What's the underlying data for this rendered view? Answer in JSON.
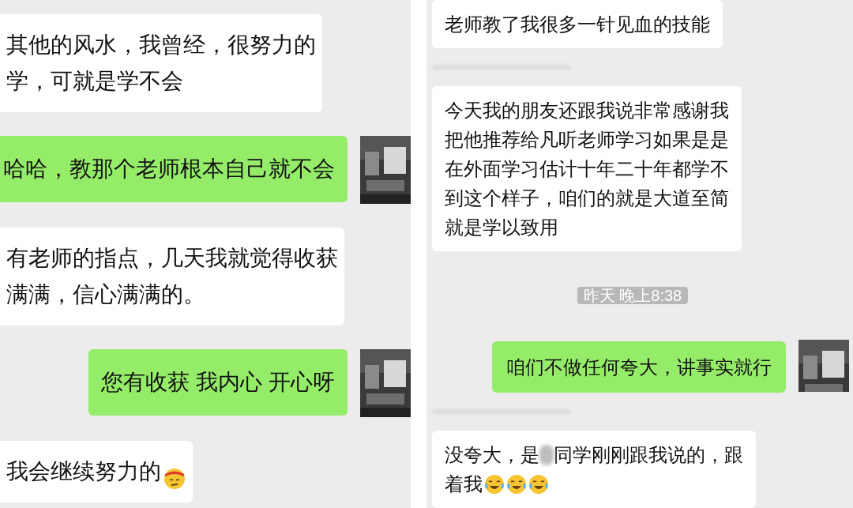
{
  "panels": [
    {
      "messages": [
        {
          "kind": "incoming",
          "lines": [
            "其他的风水，我曾经，很努力的",
            "学，可就是学不会"
          ]
        },
        {
          "kind": "outgoing",
          "lines": [
            "哈哈，教那个老师根本自己就不会"
          ]
        },
        {
          "kind": "incoming",
          "lines": [
            "有老师的指点，几天我就觉得收获",
            "满满，信心满满的。"
          ]
        },
        {
          "kind": "outgoing",
          "lines": [
            "您有收获 我内心 开心呀"
          ]
        },
        {
          "kind": "incoming",
          "lines": [
            "我会继续努力的"
          ],
          "end_icons": [
            {
              "kind": "headband-face"
            }
          ]
        }
      ]
    },
    {
      "messages": [
        {
          "kind": "incoming",
          "lines": [
            "老师教了我很多一针见血的技能"
          ]
        },
        {
          "kind": "redacted"
        },
        {
          "kind": "incoming",
          "lines": [
            "今天我的朋友还跟我说非常感谢我",
            "把他推荐给凡听老师学习如果是是",
            "在外面学习估计十年二十年都学不",
            "到这个样子，咱们的就是大道至简",
            "就是学以致用"
          ]
        },
        {
          "kind": "time",
          "text": "昨天 晚上8:38"
        },
        {
          "kind": "outgoing",
          "lines": [
            "咱们不做任何夸大，讲事实就行"
          ]
        },
        {
          "kind": "redacted"
        },
        {
          "kind": "incoming",
          "lines": [
            "没夸大，是",
            "同学刚刚跟我说的，跟",
            "着我"
          ],
          "blur_after_line": true,
          "end_icons": [
            {
              "kind": "tears-of-joy"
            },
            {
              "kind": "tears-of-joy"
            },
            {
              "kind": "tears-of-joy"
            }
          ]
        }
      ]
    }
  ]
}
